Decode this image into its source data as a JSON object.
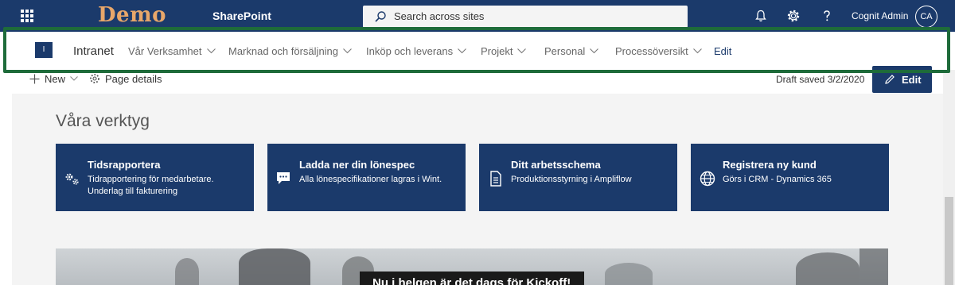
{
  "suitebar": {
    "brand": "Demo",
    "app_name": "SharePoint",
    "search_placeholder": "Search across sites",
    "user_name": "Cognit Admin",
    "user_initials": "CA",
    "icons": [
      "app-launcher-icon",
      "bell-icon",
      "gear-icon",
      "help-icon"
    ]
  },
  "hubnav": {
    "logo_text": "I",
    "site_title": "Intranet",
    "items": [
      {
        "label": "Vår Verksamhet"
      },
      {
        "label": "Marknad och försäljning"
      },
      {
        "label": "Inköp och leverans"
      },
      {
        "label": "Projekt"
      },
      {
        "label": "Personal"
      },
      {
        "label": "Processöversikt"
      }
    ],
    "edit_label": "Edit"
  },
  "commandbar": {
    "new_label": "New",
    "page_details_label": "Page details",
    "draft_status": "Draft saved 3/2/2020",
    "edit_label": "Edit"
  },
  "main": {
    "section_title": "Våra verktyg",
    "tiles": [
      {
        "title": "Tidsrapportera",
        "description": "Tidrapportering för medarbetare. Underlag till fakturering",
        "icon": "gears-icon"
      },
      {
        "title": "Ladda ner din lönespec",
        "description": "Alla lönespecifikationer lagras i Wint.",
        "icon": "chat-icon"
      },
      {
        "title": "Ditt arbetsschema",
        "description": "Produktionsstyrning i Ampliflow",
        "icon": "document-icon"
      },
      {
        "title": "Registrera ny kund",
        "description": "Görs i CRM - Dynamics 365",
        "icon": "globe-icon"
      }
    ],
    "hero_banner_text": "Nu i helgen är det dags för Kickoff!"
  },
  "colors": {
    "suitebar_bg": "#1b3a6b",
    "brand": "#e8a76a",
    "tile_bg": "#1b3a6b",
    "highlight_border": "#1e6b3a"
  }
}
